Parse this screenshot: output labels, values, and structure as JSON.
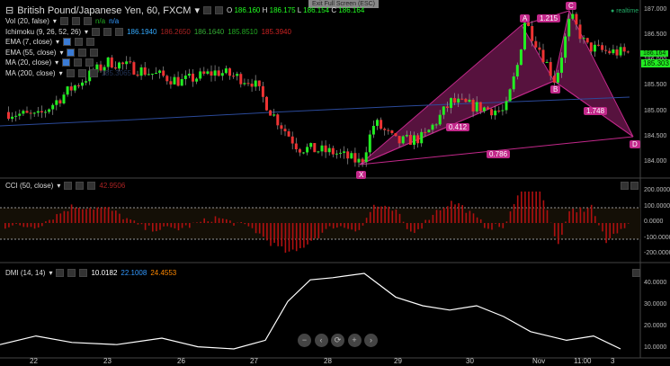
{
  "header": {
    "symbol": "British Pound/Japanese Yen, 60, FXCM",
    "o_label": "O",
    "o": "186.160",
    "h_label": "H",
    "h": "186.175",
    "l_label": "L",
    "l": "186.154",
    "c_label": "C",
    "c": "186.164",
    "exit_fullscreen": "Exit Full Screen (ESC)",
    "realtime": "realtime"
  },
  "indicators": [
    {
      "label": "Vol (20, false)",
      "values": [
        "n/a",
        "n/a"
      ],
      "colors": [
        "#2a2",
        "#39f"
      ]
    },
    {
      "label": "Ichimoku (9, 26, 52, 26)",
      "values": [
        "186.1940",
        "186.2650",
        "186.1640",
        "185.8510",
        "185.3940"
      ],
      "colors": [
        "#3af",
        "#a22",
        "#3a3",
        "#2a2",
        "#c22"
      ]
    },
    {
      "label": "EMA (7, close)",
      "values": []
    },
    {
      "label": "EMA (55, close)",
      "values": []
    },
    {
      "label": "MA (20, close)",
      "values": []
    },
    {
      "label": "MA (200, close)",
      "values": [
        "185.3065"
      ],
      "colors": [
        "#235"
      ]
    }
  ],
  "price_axis": [
    "187.000",
    "186.500",
    "186.000",
    "185.500",
    "185.000",
    "184.500",
    "184.000"
  ],
  "price_tags": [
    "186.164",
    "185.303"
  ],
  "pattern": {
    "points": {
      "X": "X",
      "A": "A",
      "B": "B",
      "C": "C",
      "D": "D"
    },
    "ratios": {
      "xb": "0.412",
      "ac": "1.215",
      "bd": "1.748",
      "xd": "0.786"
    }
  },
  "cci": {
    "label": "CCI (50, close)",
    "value": "42.9506",
    "axis": [
      "200.0000",
      "100.0000",
      "0.0000",
      "-100.0000",
      "-200.0000"
    ]
  },
  "dmi": {
    "label": "DMI (14, 14)",
    "values": [
      "10.0182",
      "22.1008",
      "24.4553"
    ],
    "colors": [
      "#fff",
      "#39f",
      "#f80"
    ],
    "axis": [
      "40.0000",
      "30.0000",
      "20.0000",
      "10.0000"
    ]
  },
  "time_axis": [
    "22",
    "23",
    "26",
    "27",
    "28",
    "29",
    "30",
    "Nov",
    "11:00",
    "3"
  ],
  "nav": [
    "−",
    "‹",
    "⟳",
    "+",
    "›"
  ],
  "price_path": [
    [
      5,
      185.0
    ],
    [
      40,
      184.9
    ],
    [
      80,
      185.5
    ],
    [
      120,
      186.0
    ],
    [
      160,
      185.8
    ],
    [
      200,
      185.6
    ],
    [
      240,
      185.8
    ],
    [
      280,
      185.6
    ],
    [
      300,
      185.0
    ],
    [
      330,
      184.3
    ],
    [
      370,
      184.2
    ],
    [
      400,
      184.0
    ],
    [
      415,
      184.8
    ],
    [
      440,
      184.4
    ],
    [
      470,
      184.5
    ],
    [
      500,
      185.2
    ],
    [
      530,
      185.1
    ],
    [
      560,
      185.0
    ],
    [
      575,
      186.0
    ],
    [
      582,
      186.8
    ],
    [
      600,
      186.2
    ],
    [
      616,
      185.6
    ],
    [
      633,
      186.9
    ],
    [
      650,
      186.3
    ],
    [
      670,
      186.2
    ],
    [
      700,
      186.16
    ]
  ],
  "dmi_path": [
    [
      0,
      12
    ],
    [
      40,
      16
    ],
    [
      80,
      13
    ],
    [
      130,
      12
    ],
    [
      180,
      15
    ],
    [
      220,
      11
    ],
    [
      260,
      10
    ],
    [
      295,
      14
    ],
    [
      320,
      32
    ],
    [
      345,
      42
    ],
    [
      370,
      43
    ],
    [
      405,
      45
    ],
    [
      440,
      34
    ],
    [
      470,
      30
    ],
    [
      500,
      28
    ],
    [
      530,
      30
    ],
    [
      560,
      25
    ],
    [
      590,
      18
    ],
    [
      630,
      14
    ],
    [
      660,
      16
    ],
    [
      690,
      10
    ]
  ]
}
